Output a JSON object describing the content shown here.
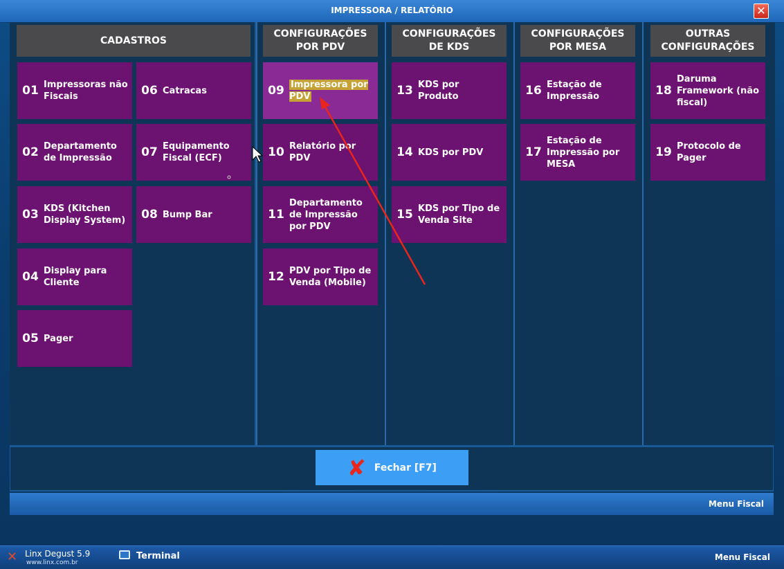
{
  "window": {
    "title": "IMPRESSORA / RELATÓRIO",
    "close_label": "✕"
  },
  "columns": [
    {
      "header": "CADASTROS"
    },
    {
      "header": "CONFIGURAÇÕES\nPOR PDV"
    },
    {
      "header": "CONFIGURAÇÕES\nDE KDS"
    },
    {
      "header": "CONFIGURAÇÕES\nPOR MESA"
    },
    {
      "header": "OUTRAS\nCONFIGURAÇÕES"
    }
  ],
  "tiles": {
    "t01": {
      "num": "01",
      "label": "Impressoras não Fiscais"
    },
    "t02": {
      "num": "02",
      "label": "Departamento de Impressão"
    },
    "t03": {
      "num": "03",
      "label": "KDS (Kitchen Display System)"
    },
    "t04": {
      "num": "04",
      "label": "Display para Cliente"
    },
    "t05": {
      "num": "05",
      "label": "Pager"
    },
    "t06": {
      "num": "06",
      "label": "Catracas"
    },
    "t07": {
      "num": "07",
      "label": "Equipamento Fiscal (ECF)"
    },
    "t08": {
      "num": "08",
      "label": "Bump Bar"
    },
    "t09": {
      "num": "09",
      "label": "Impressora por PDV"
    },
    "t10": {
      "num": "10",
      "label": "Relatório por PDV"
    },
    "t11": {
      "num": "11",
      "label": "Departamento de Impressão por PDV"
    },
    "t12": {
      "num": "12",
      "label": "PDV por Tipo de Venda (Mobile)"
    },
    "t13": {
      "num": "13",
      "label": "KDS por Produto"
    },
    "t14": {
      "num": "14",
      "label": "KDS por PDV"
    },
    "t15": {
      "num": "15",
      "label": "KDS por Tipo de Venda Site"
    },
    "t16": {
      "num": "16",
      "label": "Estação de Impressão"
    },
    "t17": {
      "num": "17",
      "label": "Estação de Impressão por MESA"
    },
    "t18": {
      "num": "18",
      "label": "Daruma Framework (não fiscal)"
    },
    "t19": {
      "num": "19",
      "label": "Protocolo de Pager"
    }
  },
  "footer": {
    "close_button": "Fechar [F7]",
    "menu_fiscal": "Menu Fiscal"
  },
  "taskbar": {
    "app_name": "Linx Degust 5.9",
    "app_url": "www.linx.com.br",
    "terminal": "Terminal",
    "menu_fiscal": "Menu Fiscal"
  },
  "colors": {
    "tile": "#6c1271",
    "tile_selected": "#8a2a95",
    "highlight": "#c5a235",
    "header": "#4a4a4c",
    "close_button": "#3c9ef4",
    "annotation_arrow": "#e8261c"
  }
}
